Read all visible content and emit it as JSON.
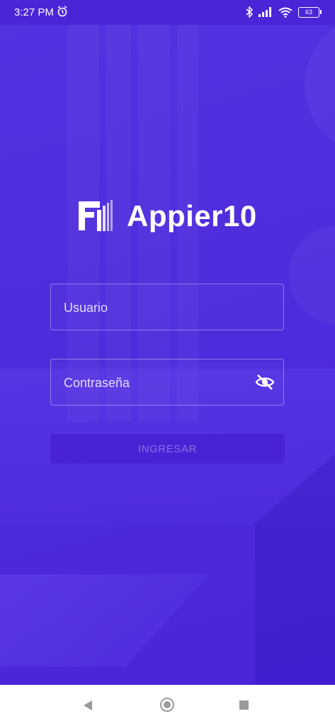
{
  "status_bar": {
    "time": "3:27 PM",
    "battery": "63",
    "icons": [
      "alarm-icon",
      "bluetooth-icon",
      "signal-icon",
      "wifi-icon",
      "battery-icon"
    ]
  },
  "brand": {
    "name": "Appier10",
    "logo_icon": "appier-logo-icon"
  },
  "login": {
    "username_placeholder": "Usuario",
    "password_placeholder": "Contraseña",
    "submit_label": "INGRESAR",
    "password_toggle_icon": "eye-off-icon"
  },
  "nav": {
    "icons": [
      "back-icon",
      "home-icon",
      "recents-icon"
    ]
  },
  "colors": {
    "primary": "#4f2ddd",
    "statusbar": "#4a25d8",
    "text": "#ffffff"
  }
}
